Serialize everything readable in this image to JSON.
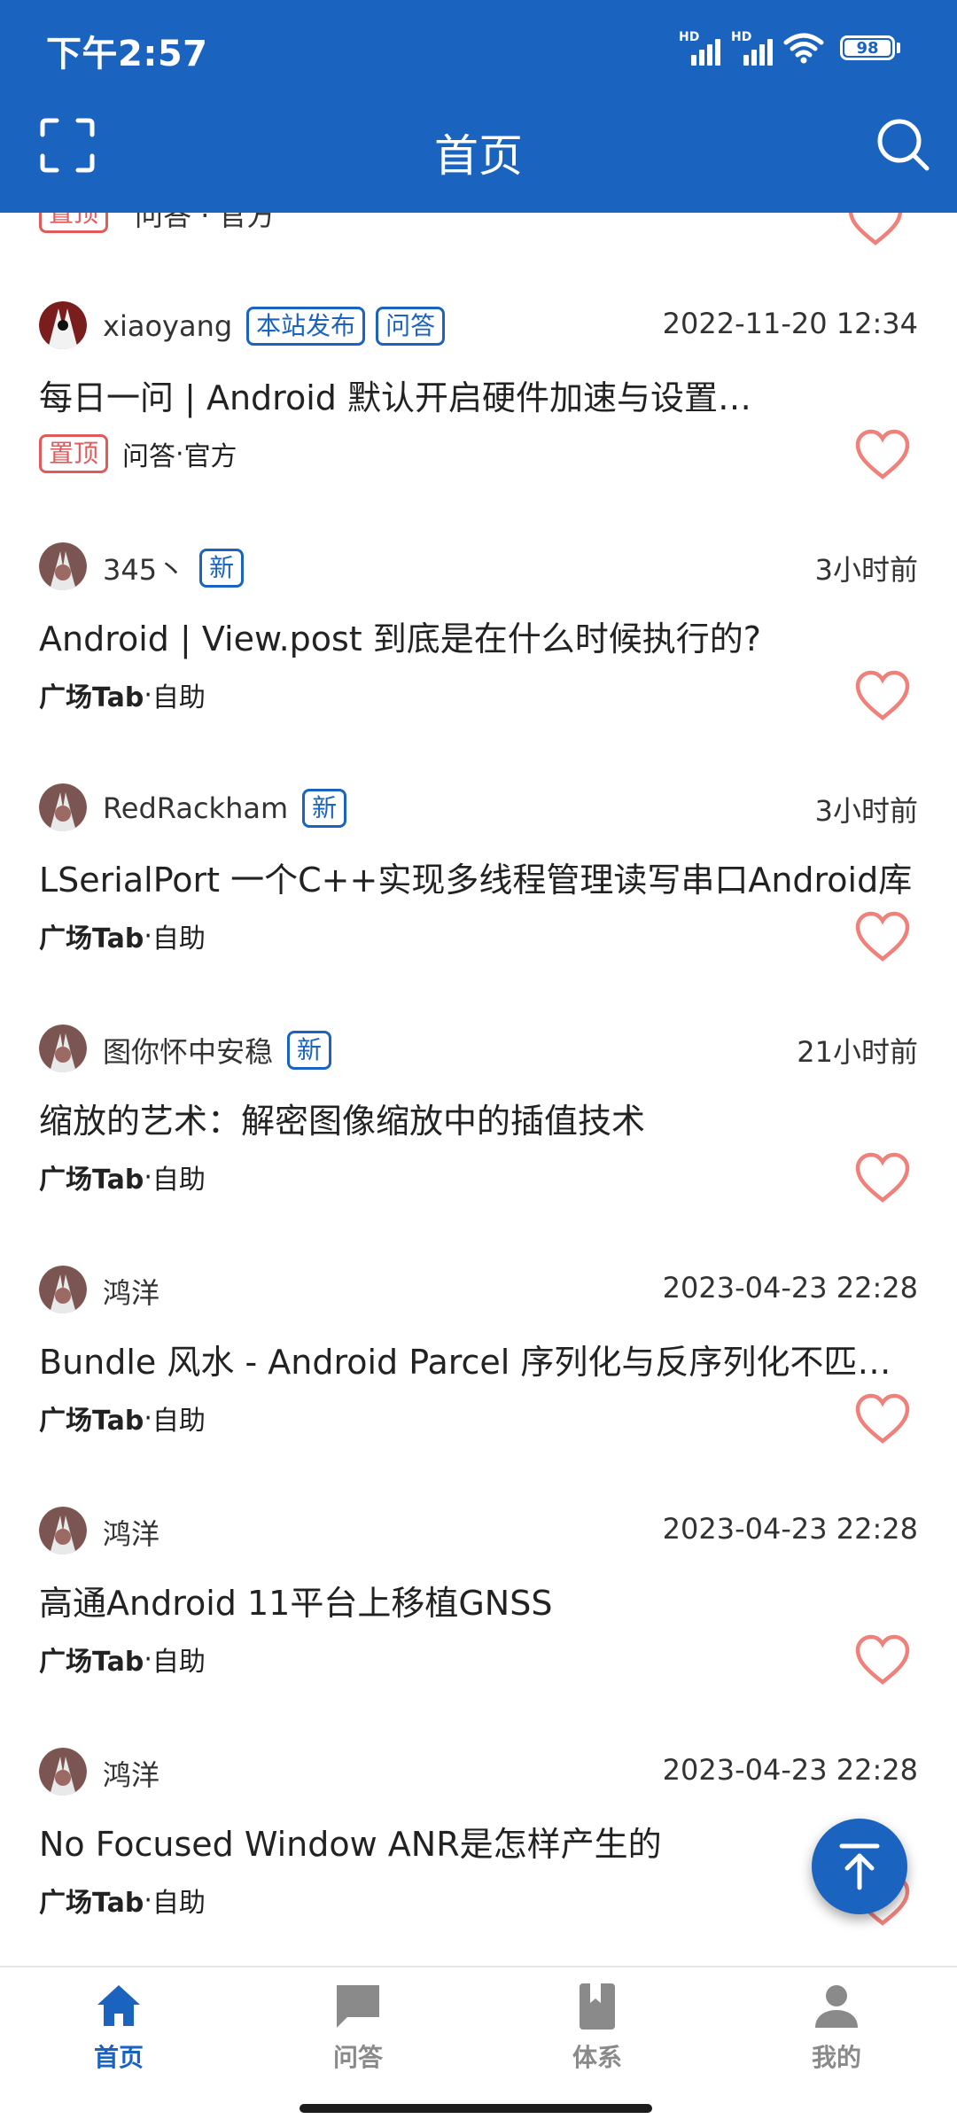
{
  "status_bar": {
    "time": "下午2:57",
    "signal1_label": "HD",
    "signal2_label": "HD",
    "battery": "98"
  },
  "header": {
    "title": "首页",
    "scan_icon": "scan-frame-icon",
    "search_icon": "search-icon"
  },
  "colors": {
    "primary": "#1a63bf",
    "pin_red": "#e05a5a",
    "heart_outline": "#f0807a"
  },
  "feed": {
    "partial_top": {
      "pin_label": "置顶",
      "meta": "问答 · 官方"
    },
    "items": [
      {
        "author": "xiaoyang",
        "tags": [
          "本站发布",
          "问答"
        ],
        "date": "2022-11-20 12:34",
        "title": "每日一问 | Android 默认开启硬件加速与设置…",
        "pinned": true,
        "pin_label": "置顶",
        "category": "问答",
        "separator": " · ",
        "source": "官方"
      },
      {
        "author": "345丶",
        "tags": [
          "新"
        ],
        "date": "3小时前",
        "title": "Android | View.post 到底是在什么时候执行的?",
        "pinned": false,
        "category": "广场Tab",
        "separator": " · ",
        "source": "自助"
      },
      {
        "author": "RedRackham",
        "tags": [
          "新"
        ],
        "date": "3小时前",
        "title": "LSerialPort 一个C++实现多线程管理读写串口Android库",
        "pinned": false,
        "category": "广场Tab",
        "separator": " · ",
        "source": "自助"
      },
      {
        "author": "图你怀中安稳",
        "tags": [
          "新"
        ],
        "date": "21小时前",
        "title": "缩放的艺术：解密图像缩放中的插值技术",
        "pinned": false,
        "category": "广场Tab",
        "separator": " · ",
        "source": "自助"
      },
      {
        "author": "鸿洋",
        "tags": [],
        "date": "2023-04-23 22:28",
        "title": "Bundle 风水 - Android Parcel 序列化与反序列化不匹配…",
        "pinned": false,
        "category": "广场Tab",
        "separator": " · ",
        "source": "自助"
      },
      {
        "author": "鸿洋",
        "tags": [],
        "date": "2023-04-23 22:28",
        "title": "高通Android 11平台上移植GNSS",
        "pinned": false,
        "category": "广场Tab",
        "separator": " · ",
        "source": "自助"
      },
      {
        "author": "鸿洋",
        "tags": [],
        "date": "2023-04-23 22:28",
        "title": "No Focused Window ANR是怎样产生的",
        "pinned": false,
        "category": "广场Tab",
        "separator": " · ",
        "source": "自助"
      }
    ]
  },
  "fab": {
    "icon": "scroll-to-top-icon"
  },
  "bottom_nav": {
    "items": [
      {
        "label": "首页",
        "icon": "home-icon",
        "active": true
      },
      {
        "label": "问答",
        "icon": "chat-bubble-icon",
        "active": false
      },
      {
        "label": "体系",
        "icon": "book-icon",
        "active": false
      },
      {
        "label": "我的",
        "icon": "person-icon",
        "active": false
      }
    ]
  }
}
